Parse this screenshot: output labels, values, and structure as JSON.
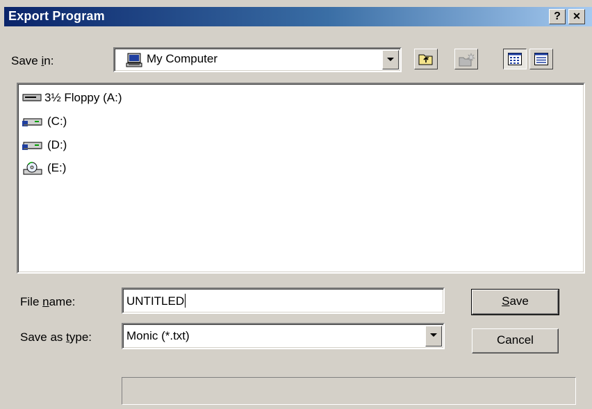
{
  "window": {
    "title": "Export Program",
    "help_label": "?",
    "close_label": "✕"
  },
  "save_in": {
    "label_prefix": "Save ",
    "label_accel": "i",
    "label_suffix": "n:",
    "value": "My Computer",
    "icon": "computer-icon"
  },
  "toolbar": [
    {
      "name": "up-one-level",
      "icon": "folder-up-icon"
    },
    {
      "name": "create-new-folder",
      "icon": "new-folder-icon"
    },
    {
      "name": "list-view",
      "icon": "list-view-icon"
    },
    {
      "name": "details-view",
      "icon": "details-view-icon"
    }
  ],
  "files": [
    {
      "label": "3½ Floppy (A:)",
      "icon": "floppy-drive-icon"
    },
    {
      "label": "(C:)",
      "icon": "hard-drive-icon"
    },
    {
      "label": "(D:)",
      "icon": "hard-drive-icon"
    },
    {
      "label": "(E:)",
      "icon": "cd-drive-icon"
    }
  ],
  "file_name": {
    "label_prefix": "File ",
    "label_accel": "n",
    "label_suffix": "ame:",
    "value": "UNTITLED"
  },
  "save_as_type": {
    "label_prefix": "Save as ",
    "label_accel": "t",
    "label_suffix": "ype:",
    "value": "Monic (*.txt)"
  },
  "buttons": {
    "save_accel": "S",
    "save_rest": "ave",
    "cancel": "Cancel"
  },
  "colors": {
    "title_start": "#0a246a",
    "title_end": "#a6caf0",
    "face": "#d4d0c8"
  }
}
